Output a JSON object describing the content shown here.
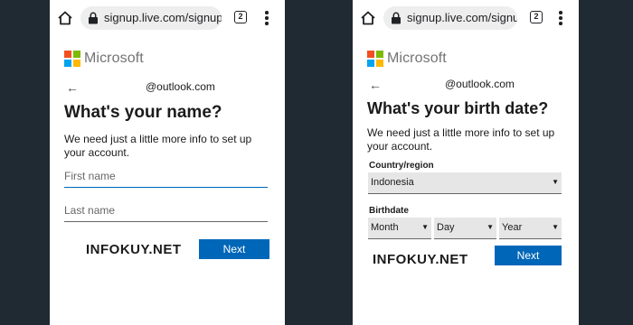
{
  "browser": {
    "url": "signup.live.com/signup",
    "tab_count": "2"
  },
  "logo": {
    "text": "Microsoft",
    "colors": [
      "#f25022",
      "#7fba00",
      "#00a4ef",
      "#ffb900"
    ]
  },
  "accent_color": "#0067b8",
  "name_screen": {
    "account": "@outlook.com",
    "title": "What's your name?",
    "description": "We need just a little more info to set up your account.",
    "first_name_placeholder": "First name",
    "last_name_placeholder": "Last name",
    "watermark": "INFOKUY.NET",
    "next_label": "Next"
  },
  "birth_screen": {
    "account": "@outlook.com",
    "title": "What's your birth date?",
    "description": "We need just a little more info to set up your account.",
    "country_label": "Country/region",
    "country_value": "Indonesia",
    "birthdate_label": "Birthdate",
    "month_value": "Month",
    "day_value": "Day",
    "year_value": "Year",
    "watermark": "INFOKUY.NET",
    "next_label": "Next"
  }
}
